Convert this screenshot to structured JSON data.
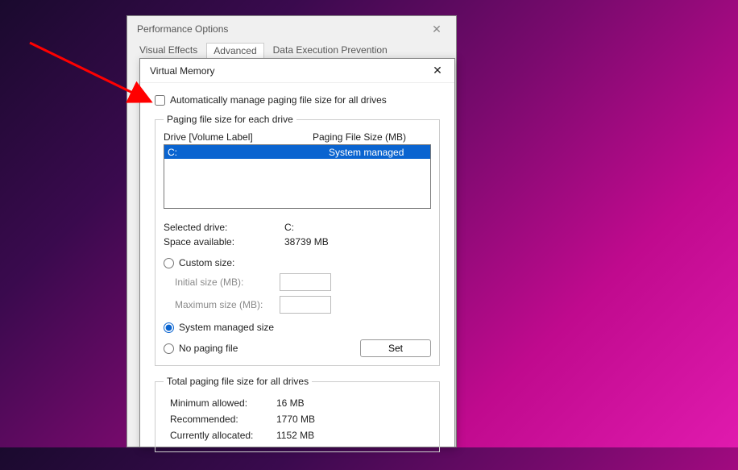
{
  "perfOptions": {
    "title": "Performance Options",
    "tabs": {
      "visualEffects": "Visual Effects",
      "advanced": "Advanced",
      "dep": "Data Execution Prevention"
    }
  },
  "virtualMemory": {
    "title": "Virtual Memory",
    "autoManage": {
      "checked": false,
      "label": "Automatically manage paging file size for all drives"
    },
    "pagingGroup": {
      "legend": "Paging file size for each drive",
      "headerDrive": "Drive  [Volume Label]",
      "headerSize": "Paging File Size (MB)",
      "rows": [
        {
          "drive": "C:",
          "size": "System managed"
        }
      ]
    },
    "selected": {
      "driveLabel": "Selected drive:",
      "driveValue": "C:",
      "spaceLabel": "Space available:",
      "spaceValue": "38739 MB"
    },
    "customSize": {
      "label": "Custom size:",
      "initialLabel": "Initial size (MB):",
      "initialValue": "",
      "maxLabel": "Maximum size (MB):",
      "maxValue": ""
    },
    "systemManaged": {
      "label": "System managed size",
      "checked": true
    },
    "noPaging": {
      "label": "No paging file",
      "checked": false
    },
    "setButton": "Set",
    "totalsGroup": {
      "legend": "Total paging file size for all drives",
      "minLabel": "Minimum allowed:",
      "minValue": "16 MB",
      "recLabel": "Recommended:",
      "recValue": "1770 MB",
      "curLabel": "Currently allocated:",
      "curValue": "1152 MB"
    }
  }
}
